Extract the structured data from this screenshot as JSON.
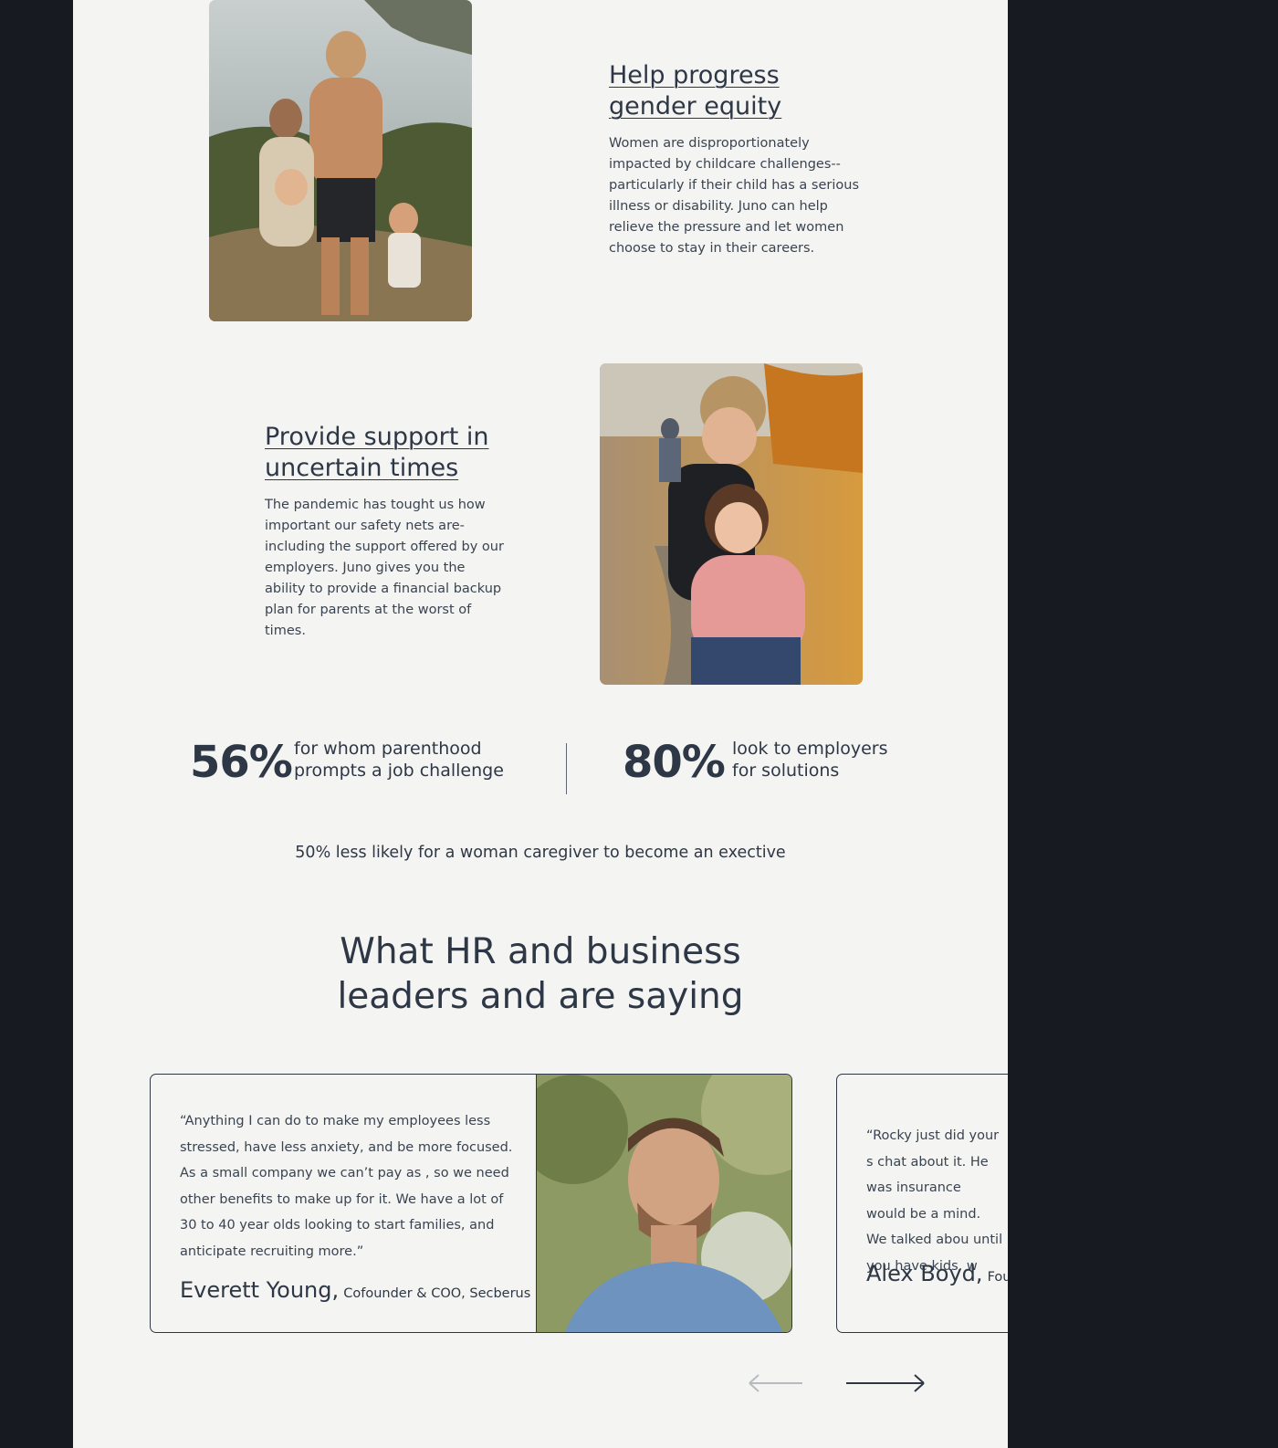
{
  "features": [
    {
      "title_line1": "Help progress",
      "title_line2": "gender equity",
      "body": "Women are disproportionately impacted by childcare challenges--particularly if their child has a serious illness or disability. Juno can help relieve the pressure and let women choose to stay in their careers."
    },
    {
      "title_line1": "Provide support in",
      "title_line2": "uncertain times",
      "body": "The pandemic has tought us how important our safety nets are-including the support offered by our employers. Juno gives you the ability to provide a financial backup plan for parents at the worst of times."
    }
  ],
  "stats": [
    {
      "value": "56%",
      "line1": "for whom parenthood",
      "line2": "prompts a job challenge"
    },
    {
      "value": "80%",
      "line1": "look to employers",
      "line2": "for solutions"
    }
  ],
  "stat_footnote": "50% less likely for a woman caregiver to become an exective",
  "testimonials_heading_line1": "What HR and business",
  "testimonials_heading_line2": "leaders and are saying",
  "testimonials": [
    {
      "quote": "“Anything I can do to make my employees less stressed, have less anxiety, and be more focused. As a small company we can’t pay as  , so we need other benefits to make up for it. We have a lot of 30 to 40 year olds looking to start families, and anticipate recruiting more.”",
      "name": "Everett Young,",
      "role": "Cofounder & COO, Secberus"
    },
    {
      "quote": "“Rocky just did your s chat about it. He was insurance would be a mind. We talked abou until you have kids, w",
      "name": "Alex Boyd,",
      "role": "Fou"
    }
  ],
  "carousel": {
    "prev": "previous-arrow",
    "next": "next-arrow"
  },
  "colors": {
    "text": "#2e3745",
    "page_bg": "#f4f4f3",
    "outer_bg": "#171b21"
  }
}
